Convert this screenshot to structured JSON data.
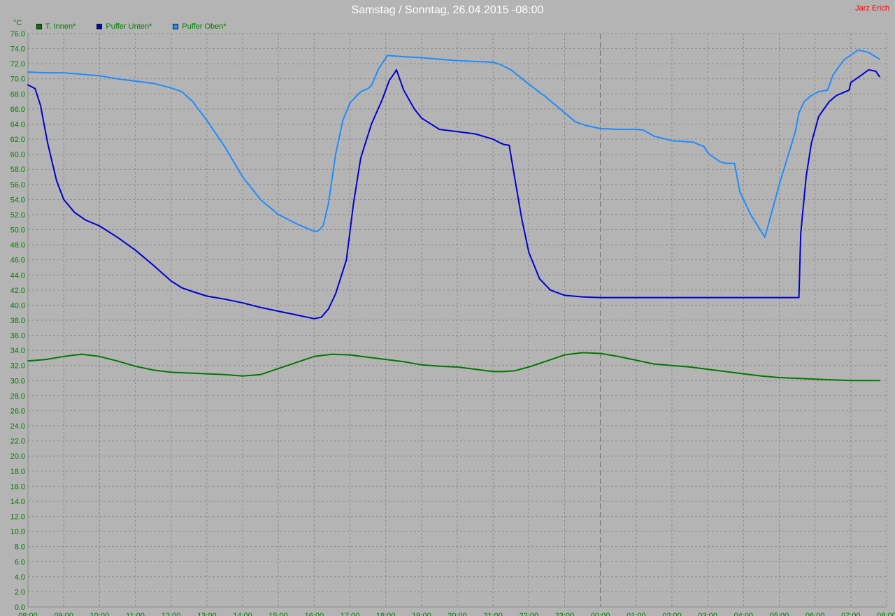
{
  "header": {
    "title": "Samstag / Sonntag, 26.04.2015  -08:00",
    "author": "Jarz Erich",
    "unit": "°C"
  },
  "colors": {
    "background": "#b4b4b4",
    "grid": "#8c8c8c",
    "axis_text": "#008000",
    "t_innen": "#007800",
    "puffer_unten": "#0000d2",
    "puffer_oben": "#1e8cff"
  },
  "chart_data": {
    "type": "line",
    "title": "Samstag / Sonntag, 26.04.2015  -08:00",
    "xlabel": "",
    "ylabel": "°C",
    "ylim": [
      0,
      76
    ],
    "xlim": [
      8,
      32
    ],
    "yticks": [
      "0.0",
      "2.0",
      "4.0",
      "6.0",
      "8.0",
      "10.0",
      "12.0",
      "14.0",
      "16.0",
      "18.0",
      "20.0",
      "22.0",
      "24.0",
      "26.0",
      "28.0",
      "30.0",
      "32.0",
      "34.0",
      "36.0",
      "38.0",
      "40.0",
      "42.0",
      "44.0",
      "46.0",
      "48.0",
      "50.0",
      "52.0",
      "54.0",
      "56.0",
      "58.0",
      "60.0",
      "62.0",
      "64.0",
      "66.0",
      "68.0",
      "70.0",
      "72.0",
      "74.0",
      "76.0"
    ],
    "xticks": [
      "08:00",
      "09:00",
      "10:00",
      "11:00",
      "12:00",
      "13:00",
      "14:00",
      "15:00",
      "16:00",
      "17:00",
      "18:00",
      "19:00",
      "20:00",
      "21:00",
      "22:00",
      "23:00",
      "00:00",
      "01:00",
      "02:00",
      "03:00",
      "04:00",
      "05:00",
      "06:00",
      "07:00",
      "08:00"
    ],
    "grid": true,
    "legend_position": "top-left",
    "series": [
      {
        "name": "T. Innen*",
        "color_key": "t_innen",
        "x": [
          8.0,
          8.5,
          9.0,
          9.5,
          10.0,
          10.5,
          11.0,
          11.5,
          12.0,
          12.5,
          13.0,
          13.5,
          14.0,
          14.5,
          15.0,
          15.5,
          16.0,
          16.5,
          17.0,
          17.5,
          18.0,
          18.5,
          19.0,
          19.5,
          20.0,
          20.5,
          21.0,
          21.3,
          21.6,
          22.0,
          22.5,
          23.0,
          23.5,
          24.0,
          24.5,
          25.0,
          25.5,
          26.0,
          26.5,
          27.0,
          27.5,
          28.0,
          28.5,
          29.0,
          29.5,
          30.0,
          30.5,
          31.0,
          31.5,
          31.8
        ],
        "values": [
          32.6,
          32.8,
          33.2,
          33.5,
          33.2,
          32.6,
          31.9,
          31.4,
          31.1,
          31.0,
          30.9,
          30.8,
          30.6,
          30.8,
          31.6,
          32.4,
          33.2,
          33.5,
          33.4,
          33.1,
          32.8,
          32.5,
          32.1,
          31.9,
          31.8,
          31.5,
          31.2,
          31.2,
          31.3,
          31.8,
          32.6,
          33.4,
          33.7,
          33.6,
          33.2,
          32.7,
          32.2,
          32.0,
          31.8,
          31.5,
          31.2,
          30.9,
          30.6,
          30.4,
          30.3,
          30.2,
          30.1,
          30.0,
          30.0,
          30.0
        ],
        "name_label": "T. Innen*"
      },
      {
        "name": "Puffer Unten*",
        "color_key": "puffer_unten",
        "x": [
          8.0,
          8.2,
          8.35,
          8.55,
          8.8,
          9.0,
          9.3,
          9.6,
          10.0,
          10.5,
          11.0,
          11.5,
          12.0,
          12.3,
          12.6,
          13.0,
          13.5,
          14.0,
          14.5,
          15.0,
          15.5,
          16.0,
          16.2,
          16.4,
          16.6,
          16.9,
          17.1,
          17.3,
          17.6,
          17.9,
          18.1,
          18.25,
          18.3,
          18.5,
          18.8,
          19.0,
          19.5,
          20.0,
          20.5,
          21.0,
          21.2,
          21.3,
          21.45,
          21.6,
          21.8,
          22.0,
          22.3,
          22.6,
          23.0,
          23.5,
          24.0,
          25.0,
          26.0,
          27.0,
          28.0,
          29.0,
          29.55,
          29.6,
          29.75,
          29.9,
          30.1,
          30.4,
          30.6,
          30.8,
          30.95,
          31.0,
          31.3,
          31.5,
          31.7,
          31.8
        ],
        "values": [
          69.2,
          68.7,
          66.5,
          61.5,
          56.5,
          54.0,
          52.3,
          51.3,
          50.5,
          49.0,
          47.3,
          45.3,
          43.2,
          42.3,
          41.8,
          41.2,
          40.8,
          40.3,
          39.7,
          39.2,
          38.7,
          38.2,
          38.4,
          39.5,
          41.5,
          46.0,
          53.5,
          59.5,
          64.0,
          67.2,
          69.8,
          70.8,
          71.2,
          68.5,
          66.0,
          64.8,
          63.3,
          63.0,
          62.7,
          62.0,
          61.5,
          61.3,
          61.2,
          57.0,
          51.5,
          47.0,
          43.5,
          42.0,
          41.3,
          41.1,
          41.0,
          41.0,
          41.0,
          41.0,
          41.0,
          41.0,
          41.0,
          49.5,
          57.0,
          61.5,
          65.0,
          67.0,
          67.8,
          68.2,
          68.5,
          69.5,
          70.5,
          71.2,
          71.0,
          70.3
        ]
      },
      {
        "name": "Puffer Oben*",
        "color_key": "puffer_oben",
        "x": [
          8.0,
          8.5,
          9.0,
          9.5,
          10.0,
          10.5,
          11.0,
          11.5,
          12.0,
          12.3,
          12.6,
          13.0,
          13.5,
          14.0,
          14.5,
          15.0,
          15.5,
          15.8,
          16.0,
          16.1,
          16.25,
          16.4,
          16.6,
          16.8,
          17.0,
          17.3,
          17.5,
          17.6,
          17.8,
          17.95,
          18.05,
          18.3,
          18.6,
          19.0,
          19.5,
          20.0,
          20.5,
          21.0,
          21.2,
          21.5,
          22.0,
          22.5,
          23.0,
          23.3,
          23.6,
          24.0,
          24.5,
          25.0,
          25.2,
          25.5,
          26.0,
          26.3,
          26.6,
          26.9,
          27.0,
          27.1,
          27.35,
          27.5,
          27.75,
          27.9,
          28.2,
          28.6,
          29.0,
          29.45,
          29.55,
          29.7,
          29.9,
          30.1,
          30.35,
          30.5,
          30.8,
          31.2,
          31.5,
          31.8
        ],
        "values": [
          70.9,
          70.8,
          70.8,
          70.6,
          70.4,
          70.0,
          69.7,
          69.4,
          68.8,
          68.3,
          67.0,
          64.5,
          61.0,
          57.0,
          54.0,
          52.0,
          50.8,
          50.2,
          49.8,
          49.8,
          50.5,
          53.5,
          60.0,
          64.5,
          66.8,
          68.3,
          68.7,
          69.1,
          71.3,
          72.4,
          73.1,
          73.0,
          72.9,
          72.8,
          72.6,
          72.4,
          72.3,
          72.2,
          71.9,
          71.2,
          69.3,
          67.5,
          65.5,
          64.3,
          63.8,
          63.4,
          63.3,
          63.3,
          63.2,
          62.4,
          61.8,
          61.7,
          61.6,
          61.0,
          60.2,
          59.8,
          59.0,
          58.8,
          58.8,
          55.0,
          52.0,
          49.0,
          56.0,
          63.0,
          65.5,
          67.0,
          67.8,
          68.3,
          68.5,
          70.5,
          72.5,
          73.8,
          73.5,
          72.6
        ]
      }
    ]
  }
}
